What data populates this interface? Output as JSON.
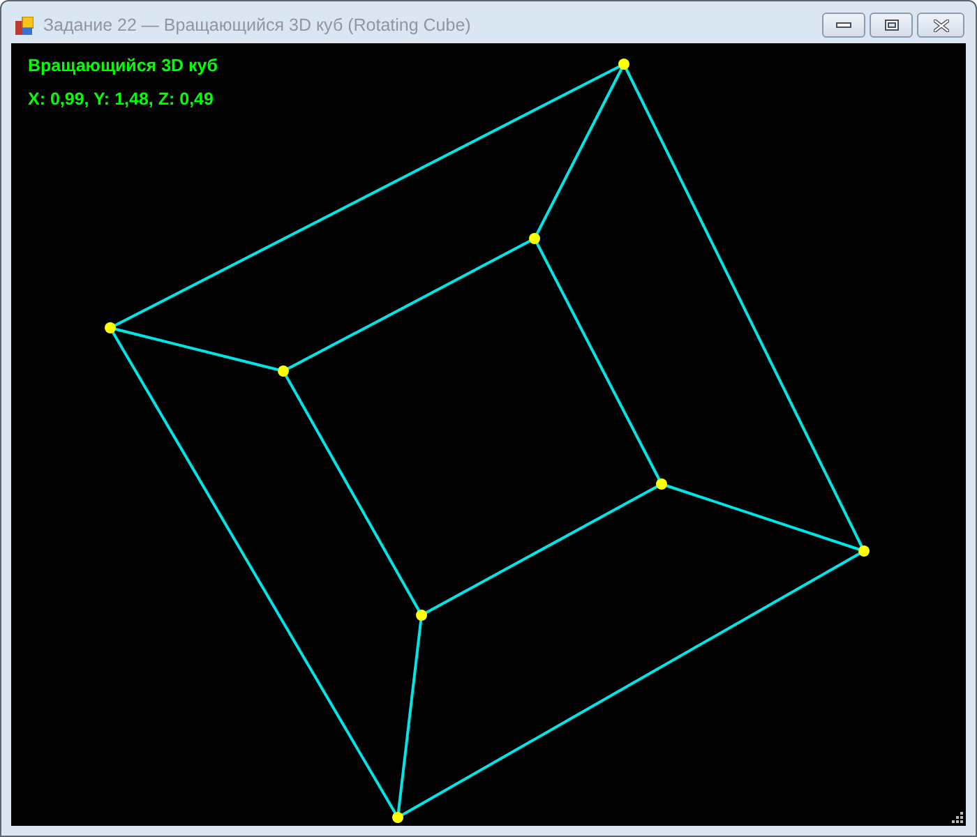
{
  "window": {
    "title": "Задание 22 — Вращающийся 3D куб (Rotating Cube)"
  },
  "canvas": {
    "heading": "Вращающийся 3D куб",
    "rotation": "X: 0,99, Y: 1,48, Z: 0,49"
  }
}
